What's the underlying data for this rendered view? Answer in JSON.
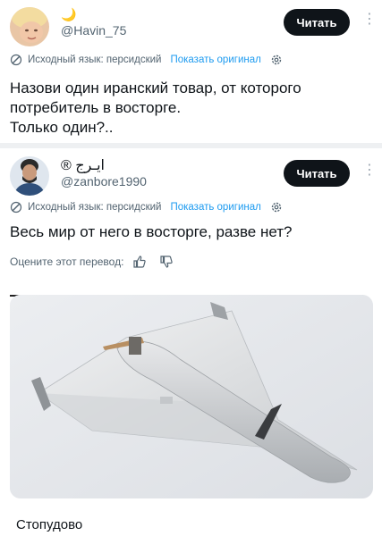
{
  "post1": {
    "emoji": "🌙",
    "handle": "@Havin_75",
    "follow_label": "Читать",
    "translate": {
      "source_label": "Исходный язык: персидский",
      "show_original": "Показать оригинал"
    },
    "text_lines": [
      "Назови один иранский товар, от которого",
      "потребитель в восторге.",
      "Только один?.."
    ]
  },
  "post2": {
    "name": "® ایـرج",
    "handle": "@zanbore1990",
    "follow_label": "Читать",
    "translate": {
      "source_label": "Исходный язык: персидский",
      "show_original": "Показать оригинал"
    },
    "text": "Весь мир от него в восторге, разве нет?",
    "rate_label": "Оцените этот перевод:"
  },
  "caption": "Стопудово",
  "colors": {
    "link": "#1d9bf0",
    "secondary_text": "#536471",
    "button_bg": "#0f1419"
  },
  "icons": [
    "translate-icon",
    "gear-icon",
    "more-icon",
    "thumbs-up-icon",
    "thumbs-down-icon"
  ]
}
